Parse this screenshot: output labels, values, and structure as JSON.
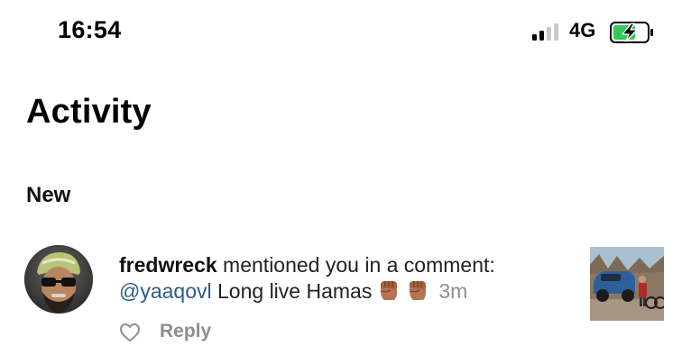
{
  "status_bar": {
    "time": "16:54",
    "network": "4G",
    "signal_bars_on": 2,
    "signal_bars_total": 4,
    "battery_charging": true,
    "battery_color": "#34c759"
  },
  "header": {
    "title": "Activity"
  },
  "sections": [
    {
      "title": "New",
      "notifications": [
        {
          "username": "fredwreck",
          "action_text": " mentioned you in a comment:",
          "mention": "@yaaqovl",
          "comment_text": " Long live Hamas",
          "emoji": [
            "raised-fist-medium-skin-tone",
            "raised-fist-medium-skin-tone"
          ],
          "time_ago": "3m",
          "reply_label": "Reply"
        }
      ]
    }
  ],
  "colors": {
    "mention": "#2d5c88",
    "secondary_text": "#8e8e8e",
    "primary_text": "#111111"
  },
  "icons": {
    "signal": "cellular-signal-icon",
    "battery": "battery-charging-icon",
    "like": "heart-outline-icon",
    "emoji": "raised-fist-icon"
  }
}
